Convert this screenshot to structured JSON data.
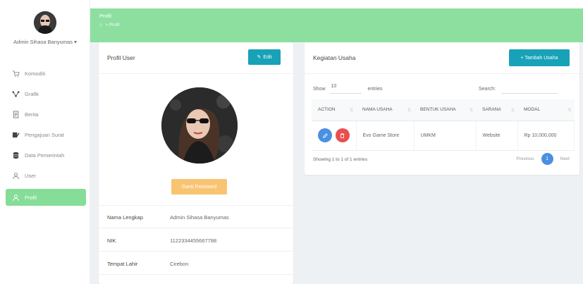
{
  "sidebar": {
    "user_name": "Admin Sihasa Banyumas",
    "items": [
      {
        "label": "Komoditi",
        "icon": "cart-icon"
      },
      {
        "label": "Grafik",
        "icon": "graph-icon"
      },
      {
        "label": "Berita",
        "icon": "document-icon"
      },
      {
        "label": "Pengajuan Surat",
        "icon": "signature-icon"
      },
      {
        "label": "Data Pemerintah",
        "icon": "database-icon"
      },
      {
        "label": "User",
        "icon": "user-icon"
      },
      {
        "label": "Profil",
        "icon": "user-icon",
        "active": true
      }
    ]
  },
  "header": {
    "title": "Profil",
    "crumb": "Profil"
  },
  "profile": {
    "title": "Profil User",
    "edit_label": "Edit",
    "password_label": "Ganti Password",
    "fields": [
      {
        "label": "Nama Lengkap",
        "value": "Admin Sihasa Banyumas"
      },
      {
        "label": "NIK",
        "value": "1122334455667788"
      },
      {
        "label": "Tempat Lahir",
        "value": "Cirebon"
      }
    ]
  },
  "kegiatan": {
    "title": "Kegiatan Usaha",
    "add_label": "+ Tambah Usaha",
    "show_label": "Show",
    "show_value": "10",
    "entries_label": "entries",
    "search_label": "Search:",
    "columns": [
      "ACTION",
      "NAMA USAHA",
      "BENTUK USAHA",
      "SARANA",
      "MODAL"
    ],
    "rows": [
      {
        "nama": "Evo Game Store",
        "bentuk": "UMKM",
        "sarana": "Website",
        "modal": "Rp 10,000,000"
      }
    ],
    "footer_info": "Showing 1 to 1 of 1 entries",
    "prev_label": "Previous",
    "page": "1",
    "next_label": "Next"
  },
  "colors": {
    "accent_green": "#8ddfa0",
    "info_blue": "#17a2b8",
    "warning_orange": "#f9c471"
  }
}
